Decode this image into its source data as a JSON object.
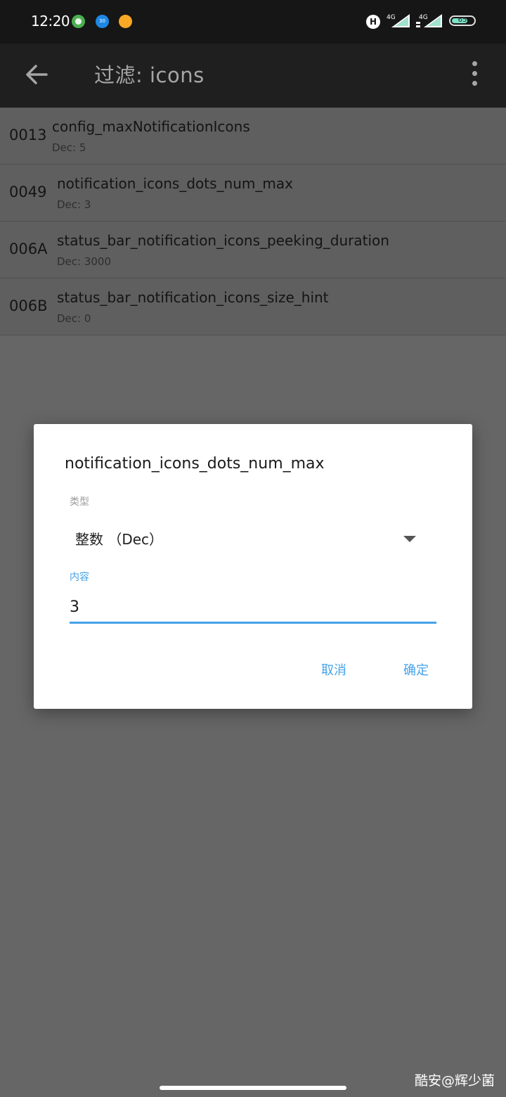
{
  "status_bar": {
    "time": "12:20",
    "notification_icons": [
      "green-circle-icon",
      "blue-app-icon",
      "orange-app-icon"
    ],
    "notification_badge_text": "30",
    "hd_badge": "H",
    "network_labels": [
      "4G",
      "4G"
    ],
    "battery_level": "65",
    "battery_percent": 65
  },
  "app_bar": {
    "title": "过滤: icons",
    "back_icon": "arrow-back-icon",
    "menu_icon": "more-vert-icon"
  },
  "list": {
    "items": [
      {
        "id": "0013",
        "name": "config_maxNotificationIcons",
        "value": "Dec: 5"
      },
      {
        "id": "0049",
        "name": "notification_icons_dots_num_max",
        "value": "Dec: 3"
      },
      {
        "id": "006A",
        "name": "status_bar_notification_icons_peeking_duration",
        "value": "Dec: 3000"
      },
      {
        "id": "006B",
        "name": "status_bar_notification_icons_size_hint",
        "value": "Dec: 0"
      }
    ]
  },
  "dialog": {
    "title": "notification_icons_dots_num_max",
    "type_label": "类型",
    "type_value": "整数 （Dec）",
    "content_label": "内容",
    "content_value": "3",
    "cancel_label": "取消",
    "ok_label": "确定"
  },
  "watermark": "酷安@辉少菌",
  "colors": {
    "accent": "#45a2e8",
    "app_bar": "#1f1f1f",
    "status_bar": "#161616",
    "scrim": "#666666"
  }
}
